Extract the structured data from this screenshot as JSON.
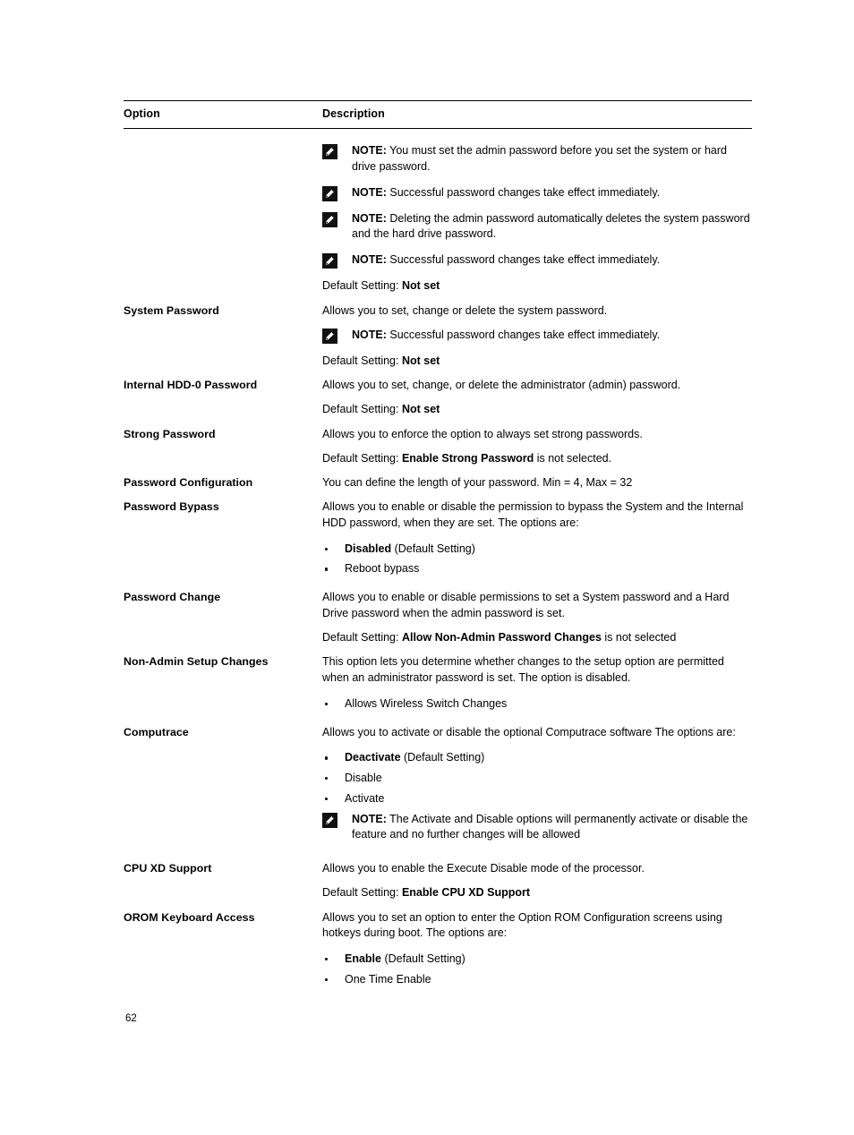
{
  "document": {
    "page_number": "62",
    "table": {
      "headers": {
        "option": "Option",
        "description": "Description"
      },
      "note_label": "NOTE:",
      "note_icon": "note-pencil-icon",
      "rows": [
        {
          "option": "",
          "blocks": [
            {
              "kind": "note",
              "text": "You must set the admin password before you set the system or hard drive password."
            },
            {
              "kind": "note",
              "text": "Successful password changes take effect immediately."
            },
            {
              "kind": "note",
              "text": "Deleting the admin password automatically deletes the system password and the hard drive password."
            },
            {
              "kind": "note",
              "text": "Successful password changes take effect immediately."
            },
            {
              "kind": "para",
              "text": "Default Setting: ",
              "bold_tail": "Not set"
            }
          ]
        },
        {
          "option": "System Password",
          "blocks": [
            {
              "kind": "para",
              "text": "Allows you to set, change or delete the system password."
            },
            {
              "kind": "note",
              "text": "Successful password changes take effect immediately."
            },
            {
              "kind": "para",
              "text": "Default Setting: ",
              "bold_tail": "Not set"
            }
          ]
        },
        {
          "option": "Internal HDD-0 Password",
          "blocks": [
            {
              "kind": "para",
              "text": "Allows you to set, change, or delete the administrator (admin) password."
            },
            {
              "kind": "para",
              "text": "Default Setting: ",
              "bold_tail": "Not set"
            }
          ]
        },
        {
          "option": "Strong Password",
          "blocks": [
            {
              "kind": "para",
              "text": "Allows you to enforce the option to always set strong passwords."
            },
            {
              "kind": "para",
              "text": "Default Setting: ",
              "bold_mid": "Enable Strong Password",
              "tail": " is not selected."
            }
          ]
        },
        {
          "option": "Password Configuration",
          "blocks": [
            {
              "kind": "para",
              "text": "You can define the length of your password. Min = 4, Max = 32"
            }
          ]
        },
        {
          "option": "Password Bypass",
          "blocks": [
            {
              "kind": "para",
              "text": "Allows you to enable or disable the permission to bypass the System and the Internal HDD password, when they are set. The options are:"
            },
            {
              "kind": "bullets",
              "items": [
                {
                  "bold": "Disabled",
                  "rest": " (Default Setting)"
                },
                {
                  "bold": "",
                  "rest": "Reboot bypass"
                }
              ]
            }
          ]
        },
        {
          "option": "Password Change",
          "blocks": [
            {
              "kind": "para",
              "text": "Allows you to enable or disable permissions to set a System password and a Hard Drive password when the admin password is set."
            },
            {
              "kind": "para",
              "text": "Default Setting: ",
              "bold_mid": "Allow Non-Admin Password Changes",
              "tail": " is not selected"
            }
          ]
        },
        {
          "option": "Non-Admin Setup Changes",
          "blocks": [
            {
              "kind": "para",
              "text": "This option lets you determine whether changes to the setup option are permitted when an administrator password is set. The option is disabled."
            },
            {
              "kind": "bullets",
              "items": [
                {
                  "bold": "",
                  "rest": "Allows Wireless Switch Changes"
                }
              ]
            }
          ]
        },
        {
          "option": "Computrace",
          "blocks": [
            {
              "kind": "para",
              "text": "Allows you to activate or disable the optional Computrace software The options are:"
            },
            {
              "kind": "bullets",
              "items": [
                {
                  "bold": "Deactivate",
                  "rest": " (Default Setting)"
                },
                {
                  "bold": "",
                  "rest": "Disable"
                },
                {
                  "bold": "",
                  "rest": "Activate"
                }
              ]
            },
            {
              "kind": "note",
              "text": "The Activate and Disable options will permanently activate or disable the feature and no further changes will be allowed"
            }
          ]
        },
        {
          "option": "CPU XD Support",
          "blocks": [
            {
              "kind": "para",
              "text": "Allows you to enable the Execute Disable mode of the processor."
            },
            {
              "kind": "para",
              "text": "Default Setting: ",
              "bold_tail": "Enable CPU XD Support"
            }
          ]
        },
        {
          "option": "OROM Keyboard Access",
          "blocks": [
            {
              "kind": "para",
              "text": "Allows you to set an option to enter the Option ROM Configuration screens using hotkeys during boot. The options are:"
            },
            {
              "kind": "bullets",
              "items": [
                {
                  "bold": "Enable",
                  "rest": " (Default Setting)"
                },
                {
                  "bold": "",
                  "rest": "One Time Enable"
                }
              ]
            }
          ]
        }
      ]
    }
  }
}
